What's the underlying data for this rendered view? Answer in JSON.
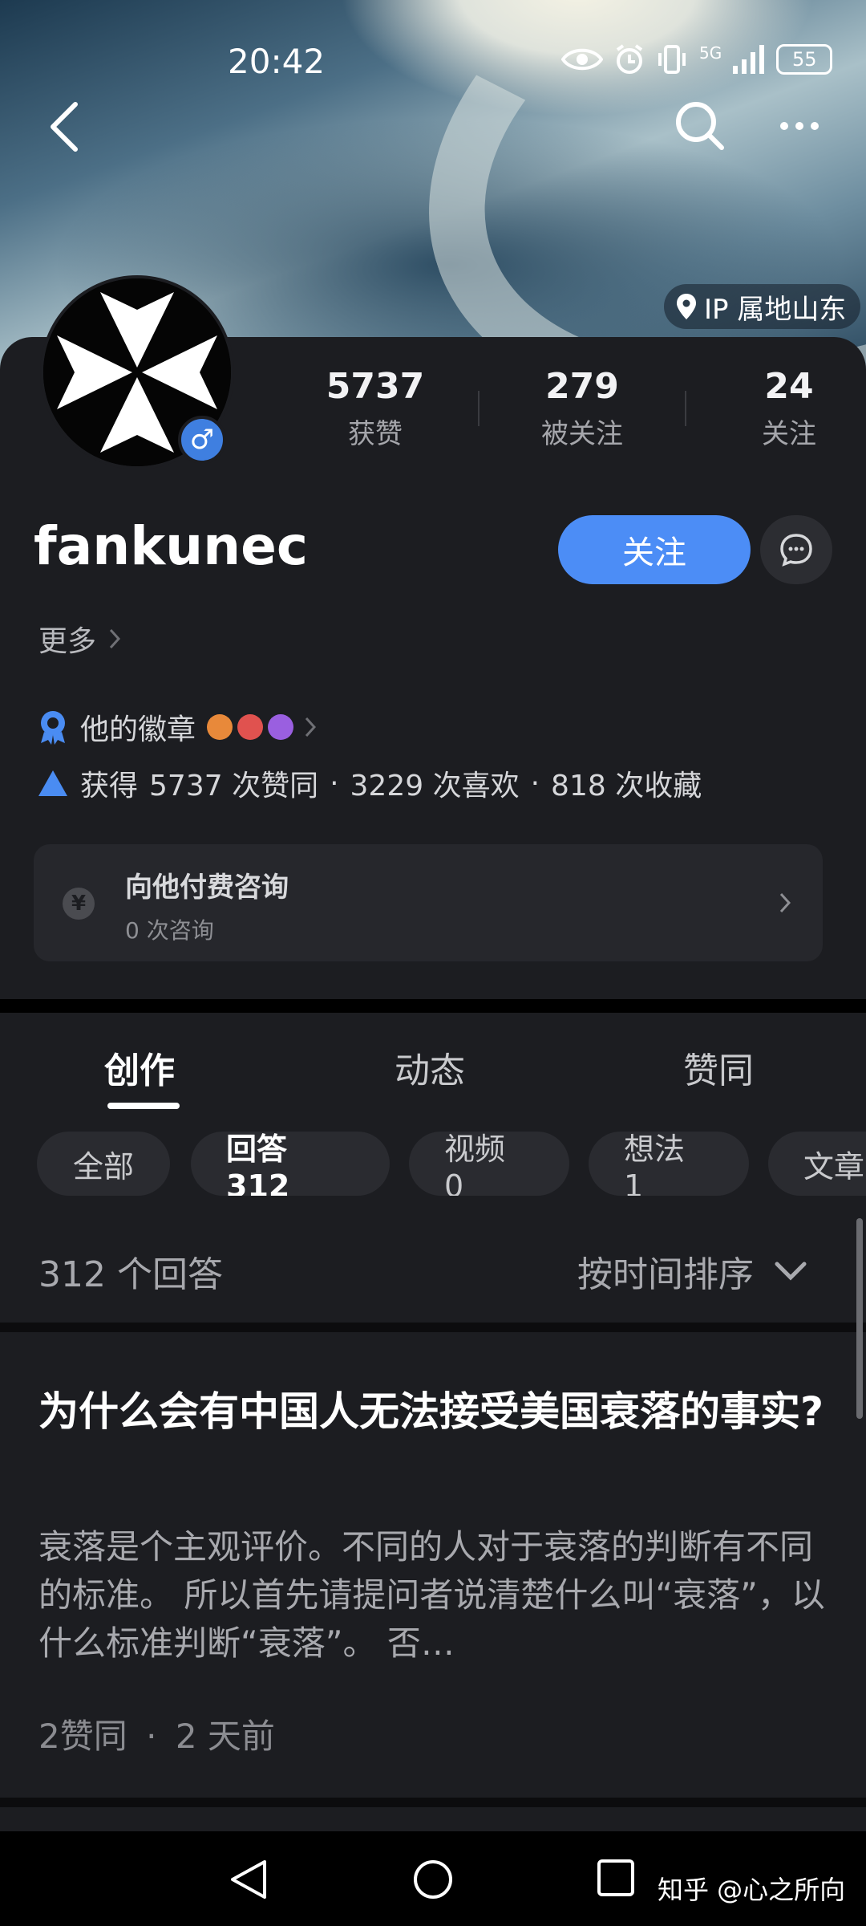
{
  "status_bar": {
    "time": "20:42",
    "network": "5G",
    "battery": "55"
  },
  "header": {
    "ip_location": "IP 属地山东"
  },
  "profile": {
    "username": "fankunec",
    "stats": [
      {
        "value": "5737",
        "label": "获赞"
      },
      {
        "value": "279",
        "label": "被关注"
      },
      {
        "value": "24",
        "label": "关注"
      }
    ],
    "follow_label": "关注",
    "more_label": "更多",
    "badge_label": "他的徽章",
    "achievement": {
      "prefix": "获得",
      "upvotes": "5737 次赞同",
      "likes": "3229 次喜欢",
      "favorites": "818 次收藏",
      "dot": "·"
    },
    "consult": {
      "title": "向他付费咨询",
      "subtitle": "0 次咨询",
      "currency_symbol": "¥"
    }
  },
  "tabs": [
    {
      "label": "创作",
      "active": true
    },
    {
      "label": "动态",
      "active": false
    },
    {
      "label": "赞同",
      "active": false
    }
  ],
  "filter_chips": [
    {
      "label": "全部",
      "active": false
    },
    {
      "label": "回答 312",
      "active": true
    },
    {
      "label": "视频 0",
      "active": false
    },
    {
      "label": "想法 1",
      "active": false
    },
    {
      "label": "文章",
      "active": false
    }
  ],
  "list_header": {
    "count_label": "312 个回答",
    "sort_label": "按时间排序"
  },
  "answer": {
    "title": "为什么会有中国人无法接受美国衰落的事实?",
    "excerpt": "衰落是个主观评价。不同的人对于衰落的判断有不同的标准。 所以首先请提问者说清楚什么叫“衰落”，以什么标准判断“衰落”。 否…",
    "meta_upvotes": "2赞同",
    "meta_time": "2 天前",
    "dot": "·"
  },
  "watermark": "知乎 @心之所向",
  "colors": {
    "accent": "#4c8df6",
    "card_bg": "#1c1d21",
    "gender_badge": "#3f7fe0"
  }
}
